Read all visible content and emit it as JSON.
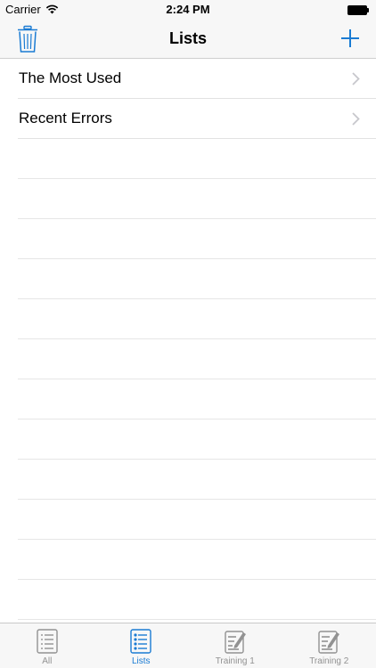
{
  "status_bar": {
    "carrier": "Carrier",
    "time": "2:24 PM"
  },
  "nav": {
    "title": "Lists"
  },
  "list": {
    "items": [
      {
        "label": "The Most Used"
      },
      {
        "label": "Recent Errors"
      }
    ]
  },
  "tab_bar": {
    "tabs": [
      {
        "label": "All",
        "icon": "list-icon",
        "active": false
      },
      {
        "label": "Lists",
        "icon": "bulleted-list-icon",
        "active": true
      },
      {
        "label": "Training 1",
        "icon": "edit-document-icon",
        "active": false
      },
      {
        "label": "Training 2",
        "icon": "edit-document-icon",
        "active": false
      }
    ]
  },
  "colors": {
    "accent": "#1a7bd3",
    "inactive": "#929292",
    "bar_background": "#f7f7f7"
  }
}
